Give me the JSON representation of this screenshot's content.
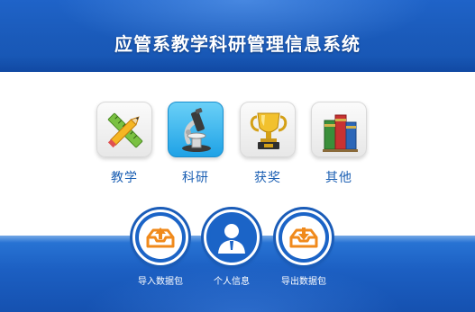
{
  "header": {
    "title": "应管系教学科研管理信息系统"
  },
  "modules": [
    {
      "label": "教学",
      "icon": "ruler-pencil-icon"
    },
    {
      "label": "科研",
      "icon": "microscope-icon"
    },
    {
      "label": "获奖",
      "icon": "trophy-icon"
    },
    {
      "label": "其他",
      "icon": "books-icon"
    }
  ],
  "actions": [
    {
      "label": "导入数据包",
      "icon": "upload-tray-icon"
    },
    {
      "label": "个人信息",
      "icon": "user-icon"
    },
    {
      "label": "导出数据包",
      "icon": "download-tray-icon"
    }
  ],
  "colors": {
    "brand_blue": "#1a5ab9",
    "label_blue": "#1b5fb3",
    "action_orange": "#f08a1c"
  }
}
